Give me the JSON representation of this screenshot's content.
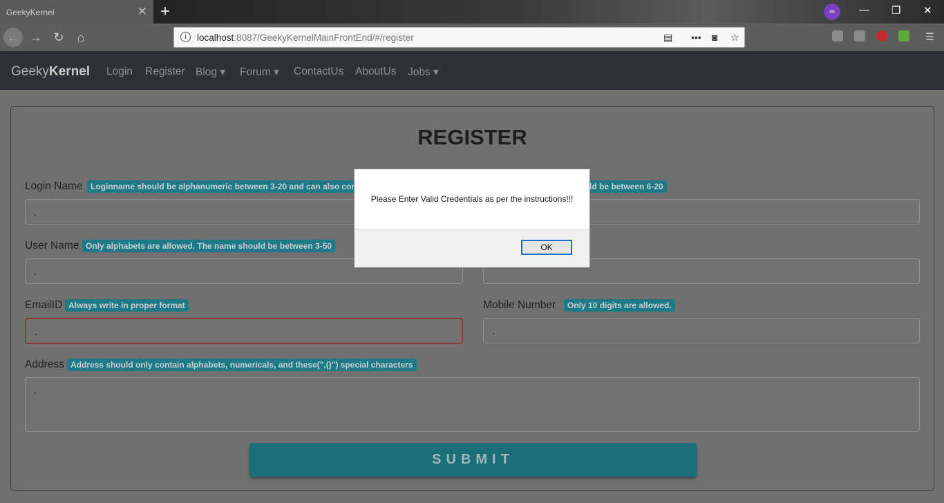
{
  "browser": {
    "tab_title": "GeekyKernel",
    "tab_close": "✕",
    "new_tab": "+",
    "url_host": "localhost",
    "url_rest": ":8087/GeekyKernelMainFrontEnd/#/register",
    "private_badge": "∞",
    "window_min": "—",
    "window_restore": "❐",
    "window_close": "✕"
  },
  "site_nav": {
    "brand_light": "Geeky",
    "brand_bold": "Kernel",
    "links": [
      "Login",
      "Register",
      "Blog ▾",
      "Forum ▾",
      "ContactUs",
      "AboutUs",
      "Jobs ▾"
    ]
  },
  "form": {
    "title": "REGISTER",
    "login_name": {
      "label": "Login Name",
      "hint": "Loginname should be alphanumeric between 3-20 and can also conta",
      "value": "."
    },
    "password_hint_tail": "ld be between 6-20",
    "right_top_value": "",
    "user_name": {
      "label": "User Name",
      "hint": "Only alphabets are allowed. The name should be between 3-50",
      "value": "."
    },
    "email": {
      "label": "EmailID",
      "hint": "Always write in proper format",
      "value": "."
    },
    "mobile": {
      "label": "Mobile Number",
      "hint": "Only 10 digits are allowed.",
      "value": "."
    },
    "address": {
      "label": "Address",
      "hint": "Address should only contain alphabets, numericals, and these(\",()\") special characters",
      "value": "."
    },
    "submit_label": "SUBMIT"
  },
  "dialog": {
    "message": "Please Enter Valid Credentials as per the instructions!!!",
    "ok_label": "OK"
  },
  "colors": {
    "hint_bg": "#1f7a87",
    "submit_bg": "#1c6e79",
    "error_border": "#8a3a3a",
    "ok_border": "#1b6fc6"
  }
}
